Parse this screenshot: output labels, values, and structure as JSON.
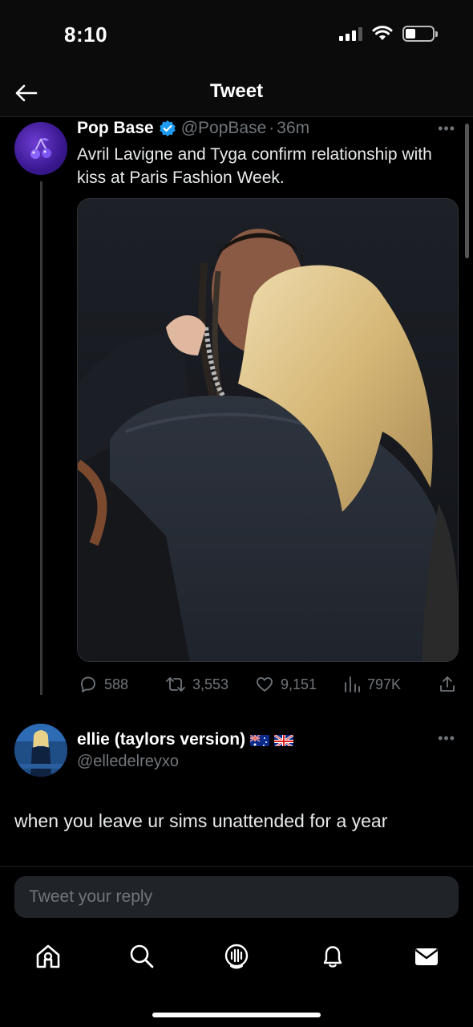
{
  "status_bar": {
    "time": "8:10"
  },
  "header": {
    "title": "Tweet"
  },
  "tweet": {
    "author_name": "Pop Base",
    "author_handle": "@PopBase",
    "separator": "·",
    "time_ago": "36m",
    "text": "Avril Lavigne and Tyga confirm relationship with kiss at Paris Fashion Week.",
    "stats": {
      "replies": "588",
      "retweets": "3,553",
      "likes": "9,151",
      "views": "797K"
    }
  },
  "reply": {
    "author_name": "ellie (taylors version)",
    "author_handle": "@elledelreyxo",
    "text": "when you leave ur sims unattended for a year"
  },
  "compose": {
    "placeholder": "Tweet your reply"
  },
  "colors": {
    "background": "#000000",
    "verified": "#1d9bf0",
    "muted": "#71767b",
    "accent_avatar": "#3a1890"
  }
}
